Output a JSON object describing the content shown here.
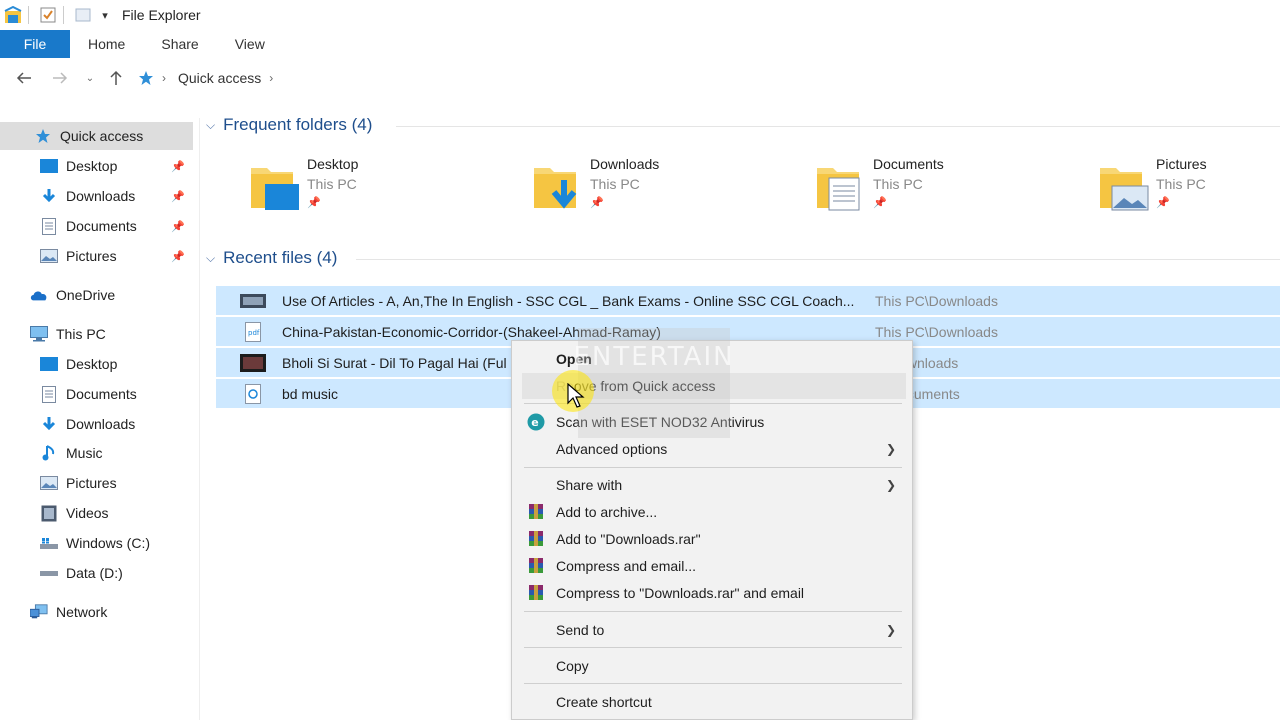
{
  "window": {
    "title": "File Explorer"
  },
  "ribbon": {
    "tabs": [
      "File",
      "Home",
      "Share",
      "View"
    ]
  },
  "address": {
    "crumb": "Quick access"
  },
  "sidebar": {
    "items": [
      {
        "label": "Quick access",
        "icon": "star-icon",
        "pinned": false
      },
      {
        "label": "Desktop",
        "icon": "desktop-icon",
        "pinned": true
      },
      {
        "label": "Downloads",
        "icon": "downloads-icon",
        "pinned": true
      },
      {
        "label": "Documents",
        "icon": "documents-icon",
        "pinned": true
      },
      {
        "label": "Pictures",
        "icon": "pictures-icon",
        "pinned": true
      },
      {
        "label": "OneDrive",
        "icon": "onedrive-icon",
        "pinned": false
      },
      {
        "label": "This PC",
        "icon": "this-pc-icon",
        "pinned": false
      },
      {
        "label": "Desktop",
        "icon": "desktop-icon",
        "pinned": false
      },
      {
        "label": "Documents",
        "icon": "documents-icon",
        "pinned": false
      },
      {
        "label": "Downloads",
        "icon": "downloads-icon",
        "pinned": false
      },
      {
        "label": "Music",
        "icon": "music-icon",
        "pinned": false
      },
      {
        "label": "Pictures",
        "icon": "pictures-icon",
        "pinned": false
      },
      {
        "label": "Videos",
        "icon": "videos-icon",
        "pinned": false
      },
      {
        "label": "Windows (C:)",
        "icon": "drive-icon",
        "pinned": false
      },
      {
        "label": "Data (D:)",
        "icon": "drive-icon",
        "pinned": false
      },
      {
        "label": "Network",
        "icon": "network-icon",
        "pinned": false
      }
    ]
  },
  "frequent": {
    "header": "Frequent folders (4)",
    "folders": [
      {
        "name": "Desktop",
        "location": "This PC",
        "icon": "desktop-folder-icon"
      },
      {
        "name": "Downloads",
        "location": "This PC",
        "icon": "downloads-folder-icon"
      },
      {
        "name": "Documents",
        "location": "This PC",
        "icon": "documents-folder-icon"
      },
      {
        "name": "Pictures",
        "location": "This PC",
        "icon": "pictures-folder-icon"
      }
    ]
  },
  "recent": {
    "header": "Recent files (4)",
    "files": [
      {
        "name": "Use Of Articles - A, An,The In English - SSC CGL _ Bank Exams - Online SSC CGL Coach...",
        "path": "This PC\\Downloads",
        "icon": "video-file-icon"
      },
      {
        "name": "China-Pakistan-Economic-Corridor-(Shakeel-Ahmad-Ramay)",
        "path": "This PC\\Downloads",
        "icon": "pdf-file-icon"
      },
      {
        "name": "Bholi Si Surat - Dil To Pagal Hai (Ful",
        "path": "C\\Downloads",
        "icon": "video-file-icon"
      },
      {
        "name": "bd music",
        "path": "C\\Documents",
        "icon": "media-file-icon"
      }
    ]
  },
  "context_menu": {
    "items": [
      {
        "label": "Open",
        "bold": true
      },
      {
        "label": "ove from Quick access",
        "prefix": "Re"
      },
      {
        "label": "Scan with ESET NOD32 Antivirus",
        "icon": "eset-icon"
      },
      {
        "label": "Advanced options",
        "submenu": true
      },
      {
        "label": "Share with",
        "submenu": true
      },
      {
        "label": "Add to archive...",
        "icon": "winrar-icon"
      },
      {
        "label": "Add to \"Downloads.rar\"",
        "icon": "winrar-icon"
      },
      {
        "label": "Compress and email...",
        "icon": "winrar-icon"
      },
      {
        "label": "Compress to \"Downloads.rar\" and email",
        "icon": "winrar-icon"
      },
      {
        "label": "Send to",
        "submenu": true
      },
      {
        "label": "Copy"
      },
      {
        "label": "Create shortcut"
      }
    ]
  },
  "watermark": "ENTERTAIN",
  "colors": {
    "accent": "#1979ca",
    "selection": "#cde8ff",
    "header_text": "#1e4e8c"
  }
}
